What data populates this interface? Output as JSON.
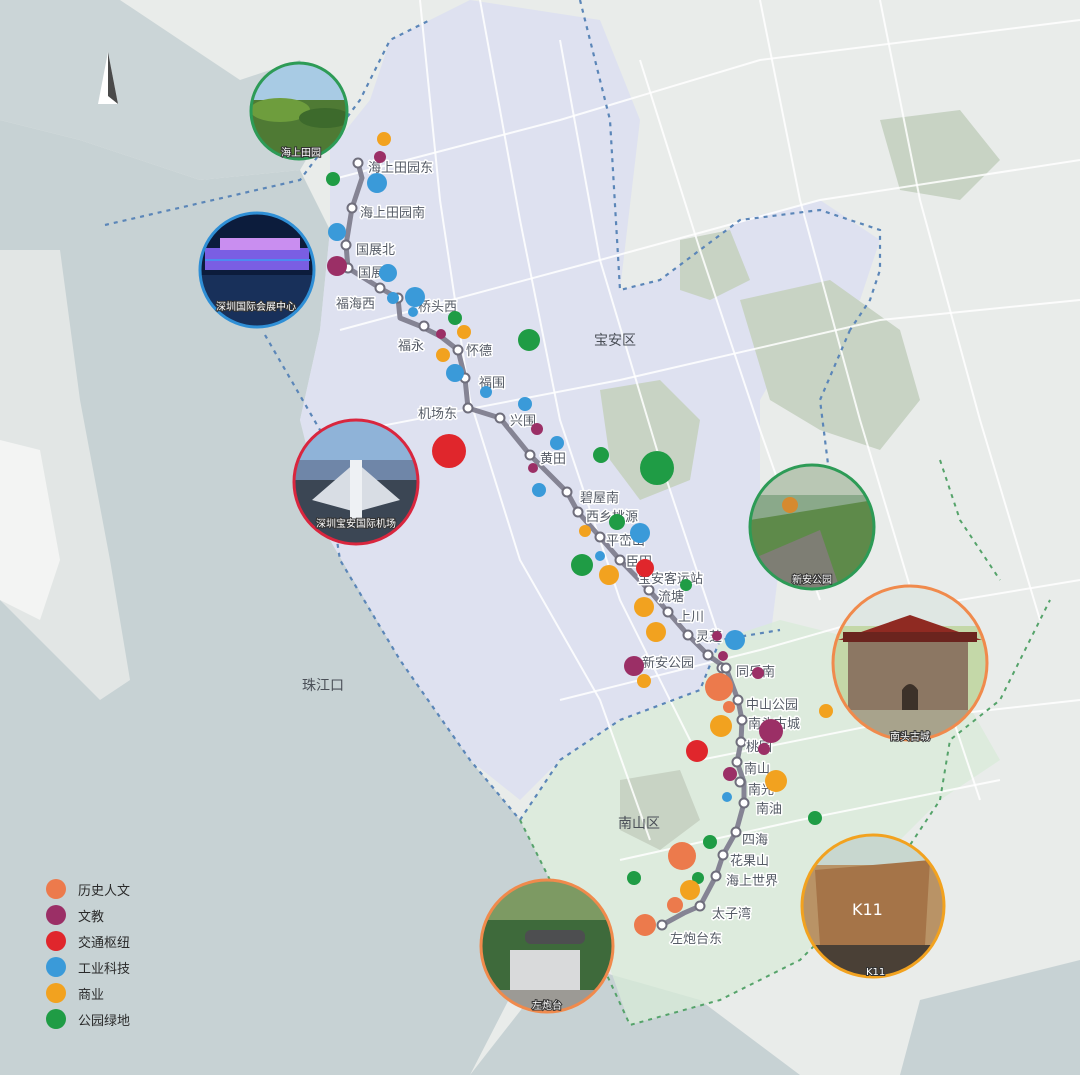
{
  "districts": {
    "baoan": "宝安区",
    "nanshan": "南山区",
    "estuary": "珠江口"
  },
  "stations": [
    "海上田园东",
    "海上田园南",
    "国展北",
    "国展",
    "福海西",
    "桥头西",
    "福永",
    "怀德",
    "福围",
    "机场东",
    "兴围",
    "黄田",
    "碧屋南",
    "西乡桃源",
    "平峦山",
    "臣田",
    "宝安客运站",
    "流塘",
    "上川",
    "灵芝",
    "新安公园",
    "同乐南",
    "中山公园",
    "南头古城",
    "桃园",
    "南山",
    "南光",
    "南油",
    "四海",
    "花果山",
    "海上世界",
    "太子湾",
    "左炮台东"
  ],
  "photos": [
    {
      "id": "haishang",
      "caption": "海上田园"
    },
    {
      "id": "expo",
      "caption": "深圳国际会展中心"
    },
    {
      "id": "airport",
      "caption": "深圳宝安国际机场"
    },
    {
      "id": "xinan",
      "caption": "新安公园"
    },
    {
      "id": "nantou",
      "caption": "南头古城"
    },
    {
      "id": "k11",
      "caption": "K11"
    },
    {
      "id": "zuopaotai",
      "caption": "左炮台"
    }
  ],
  "legend": [
    {
      "label": "历史人文",
      "color": "#ec7a4c"
    },
    {
      "label": "文教",
      "color": "#9b2f66"
    },
    {
      "label": "交通枢纽",
      "color": "#e0262c"
    },
    {
      "label": "工业科技",
      "color": "#3a9ad9"
    },
    {
      "label": "商业",
      "color": "#f2a21f"
    },
    {
      "label": "公园绿地",
      "color": "#1f9c45"
    }
  ]
}
